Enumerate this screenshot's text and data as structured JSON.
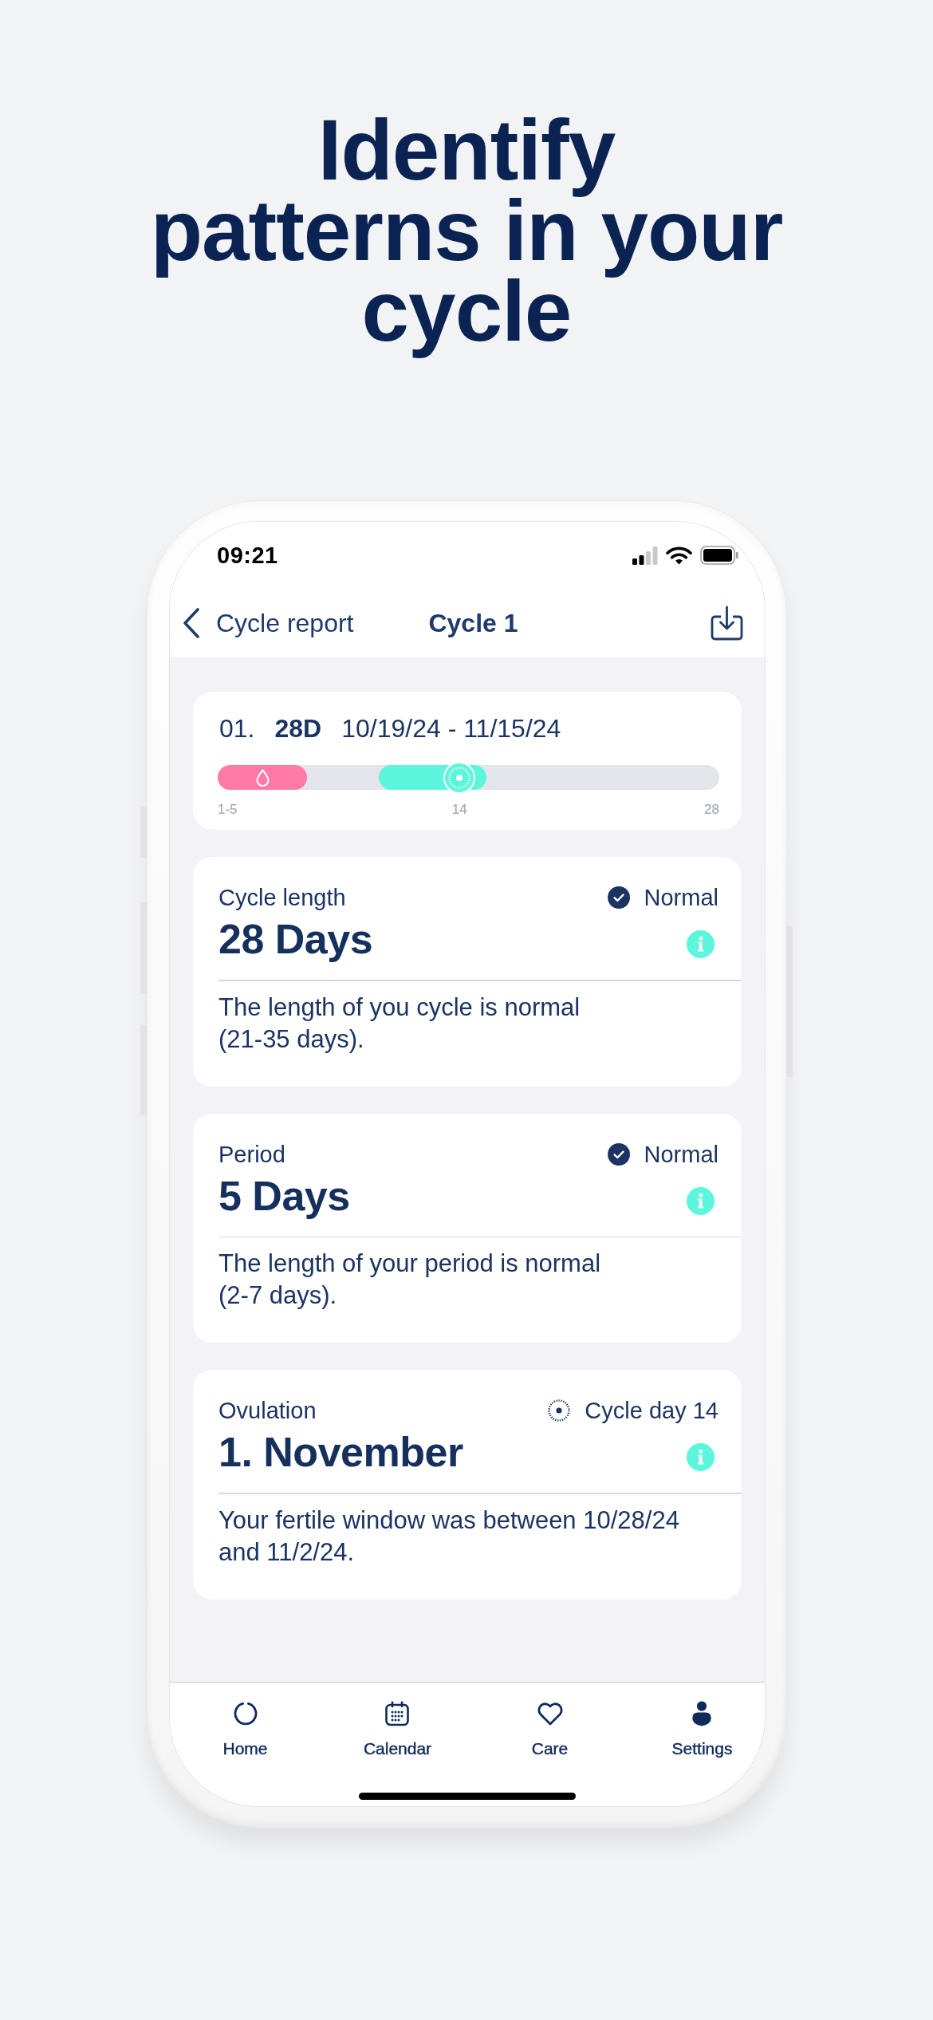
{
  "headline": "Identify\npatterns in your\ncycle",
  "status_bar": {
    "time": "09:21"
  },
  "nav": {
    "back": "Cycle report",
    "title": "Cycle 1"
  },
  "cycle_summary": {
    "number": "01.",
    "length": "28D",
    "dates": "10/19/24 - 11/15/24",
    "timeline": {
      "days": [
        {
          "kind": "period",
          "label": "1-5"
        },
        {
          "kind": "period"
        },
        {
          "kind": "period"
        },
        {
          "kind": "period"
        },
        {
          "kind": "period"
        },
        {
          "kind": "none"
        },
        {
          "kind": "none"
        },
        {
          "kind": "none"
        },
        {
          "kind": "none"
        },
        {
          "kind": "fertile"
        },
        {
          "kind": "fertile"
        },
        {
          "kind": "fertile"
        },
        {
          "kind": "fertile"
        },
        {
          "kind": "ovulation",
          "label": "14"
        },
        {
          "kind": "fertile"
        },
        {
          "kind": "none"
        },
        {
          "kind": "none"
        },
        {
          "kind": "none"
        },
        {
          "kind": "none"
        },
        {
          "kind": "none"
        },
        {
          "kind": "none"
        },
        {
          "kind": "none"
        },
        {
          "kind": "none"
        },
        {
          "kind": "none"
        },
        {
          "kind": "none"
        },
        {
          "kind": "none"
        },
        {
          "kind": "none"
        },
        {
          "kind": "none",
          "label": "28"
        }
      ]
    }
  },
  "metrics": [
    {
      "label": "Cycle length",
      "value": "28 Days",
      "status": {
        "kind": "check",
        "text": "Normal"
      },
      "description": "The length of you cycle is normal\n(21-35 days)."
    },
    {
      "label": "Period",
      "value": "5 Days",
      "status": {
        "kind": "check",
        "text": "Normal"
      },
      "description": "The length of your period is normal\n(2-7 days)."
    },
    {
      "label": "Ovulation",
      "value": "1. November",
      "status": {
        "kind": "ovulation",
        "text": "Cycle day 14"
      },
      "description": "Your fertile window was between 10/28/24\nand 11/2/24."
    }
  ],
  "tab_bar": [
    {
      "kind": "home",
      "label": "Home"
    },
    {
      "kind": "calendar",
      "label": "Calendar"
    },
    {
      "kind": "care",
      "label": "Care"
    },
    {
      "kind": "settings",
      "label": "Settings"
    }
  ]
}
